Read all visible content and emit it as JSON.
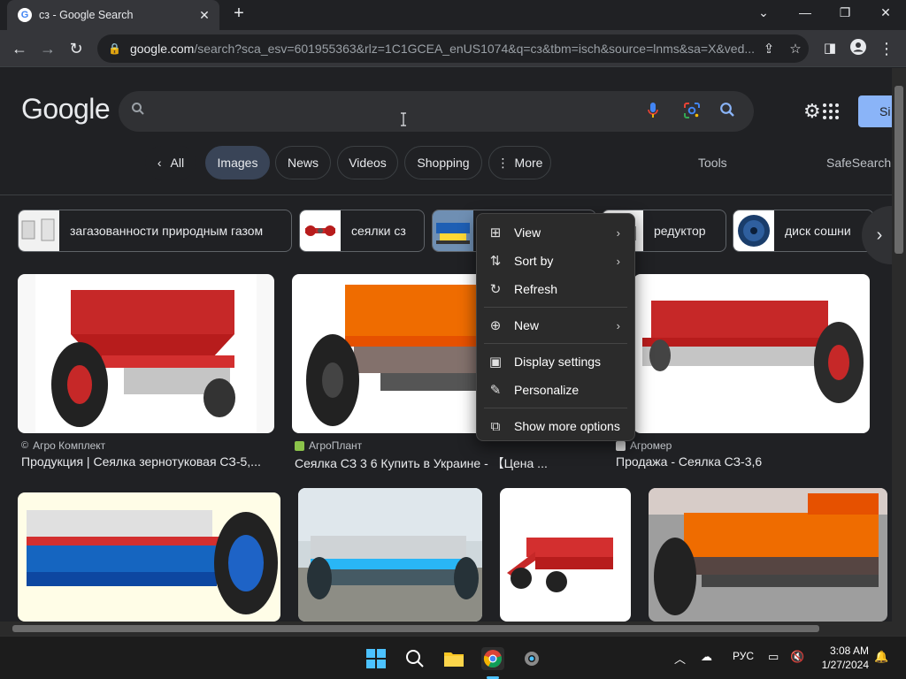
{
  "browser": {
    "tab_title": "сз - Google Search",
    "url_host": "google.com",
    "url_rest": "/search?sca_esv=601955363&rlz=1C1GCEA_enUS1074&q=сз&tbm=isch&source=lnms&sa=X&ved..."
  },
  "google": {
    "logo": "Google",
    "search_value": "",
    "signin_label": "Si"
  },
  "filters": {
    "all": "All",
    "images": "Images",
    "news": "News",
    "videos": "Videos",
    "shopping": "Shopping",
    "more": "More",
    "tools": "Tools",
    "safesearch": "SafeSearch"
  },
  "related": [
    {
      "label": "загазованности природным газом"
    },
    {
      "label": "сеялки сз"
    },
    {
      "label": ""
    },
    {
      "label": "редуктор"
    },
    {
      "label": "диск сошни"
    }
  ],
  "results_row1": [
    {
      "source": "Агро Комплект",
      "caption": "Продукция | Сеялка зернотуковая СЗ-5,..."
    },
    {
      "source": "АгроПлант",
      "caption": "Сеялка СЗ 3 6 Купить в Украине - 【Цена ..."
    },
    {
      "source": "Агромер",
      "caption": "Продажа - Сеялка СЗ-3,6"
    }
  ],
  "context_menu": {
    "items": [
      {
        "label": "View",
        "icon": "view-grid-icon",
        "submenu": true
      },
      {
        "label": "Sort by",
        "icon": "sort-icon",
        "submenu": true
      },
      {
        "label": "Refresh",
        "icon": "refresh-icon",
        "submenu": false
      },
      {
        "label": "New",
        "icon": "plus-circle-icon",
        "submenu": true
      },
      {
        "label": "Display settings",
        "icon": "display-icon",
        "submenu": false
      },
      {
        "label": "Personalize",
        "icon": "brush-icon",
        "submenu": false
      },
      {
        "label": "Show more options",
        "icon": "more-options-icon",
        "submenu": false
      }
    ]
  },
  "taskbar": {
    "language": "РУС",
    "time": "3:08 AM",
    "date": "1/27/2024"
  },
  "colors": {
    "background": "#202124",
    "chip_active": "#394457",
    "signin": "#8ab4f8",
    "menu_bg": "#2b2b2b"
  }
}
